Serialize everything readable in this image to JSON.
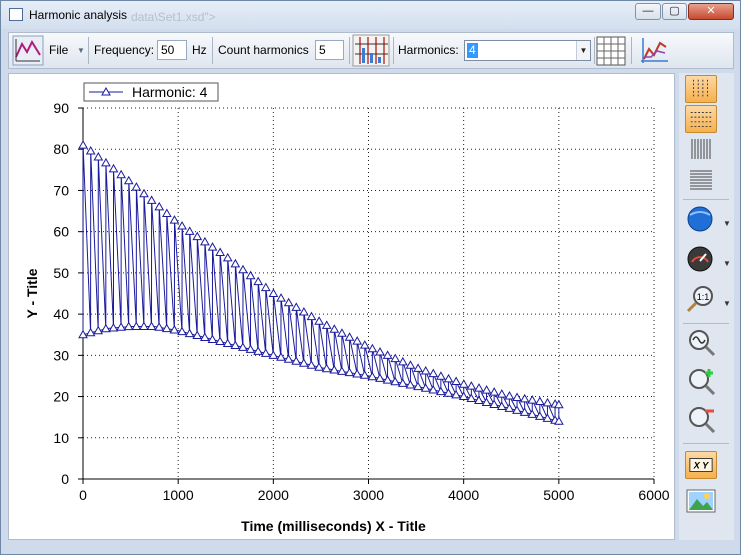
{
  "window": {
    "title": "Harmonic analysis",
    "ghost_text": "data\\Set1.xsd\">",
    "minimize_label": "—",
    "maximize_label": "▢",
    "close_label": "✕"
  },
  "toolbar": {
    "file_label": "File",
    "frequency_label": "Frequency:",
    "frequency_value": "50",
    "frequency_unit": "Hz",
    "count_label": "Count harmonics",
    "count_value": "5",
    "harmonics_label": "Harmonics:",
    "harmonics_selected": "4"
  },
  "colors": {
    "series": "#1a1a9c",
    "accent": "#f6b04e",
    "grid": "#222222"
  },
  "rightbar_icons": [
    "vertical-grid-icon",
    "horizontal-grid-icon",
    "fine-vertical-grid-icon",
    "fine-horizontal-grid-icon",
    "color-globe-icon",
    "speedometer-icon",
    "zoom-1-1-icon",
    "zoom-wave-icon",
    "zoom-in-icon",
    "zoom-out-icon",
    "xy-axis-icon",
    "export-image-icon"
  ],
  "chart_data": {
    "type": "line",
    "legend": "Harmonic: 4",
    "legend_position": "top-left",
    "xlabel": "Time (milliseconds) X - Title",
    "ylabel": "Y - Title",
    "xlim": [
      0,
      6000
    ],
    "ylim": [
      0,
      90
    ],
    "grid": true,
    "x_ticks": [
      0,
      1000,
      2000,
      3000,
      4000,
      5000,
      6000
    ],
    "y_ticks": [
      0,
      10,
      20,
      30,
      40,
      50,
      60,
      70,
      80,
      90
    ],
    "series": [
      {
        "name": "Harmonic: 4",
        "period_ms": 80,
        "x_start": 0,
        "x_end": 5000,
        "upper_envelope": [
          [
            0,
            81
          ],
          [
            500,
            72
          ],
          [
            1000,
            62
          ],
          [
            1500,
            54
          ],
          [
            2000,
            45
          ],
          [
            2500,
            38
          ],
          [
            3000,
            32
          ],
          [
            3500,
            27
          ],
          [
            4000,
            23
          ],
          [
            4500,
            20
          ],
          [
            5000,
            18
          ]
        ],
        "lower_envelope": [
          [
            0,
            35
          ],
          [
            250,
            36.5
          ],
          [
            500,
            37
          ],
          [
            750,
            37
          ],
          [
            1000,
            36
          ],
          [
            1500,
            33
          ],
          [
            2000,
            30
          ],
          [
            2500,
            27
          ],
          [
            3000,
            25
          ],
          [
            3500,
            22.5
          ],
          [
            4000,
            20
          ],
          [
            4500,
            17
          ],
          [
            5000,
            14
          ]
        ]
      }
    ]
  }
}
